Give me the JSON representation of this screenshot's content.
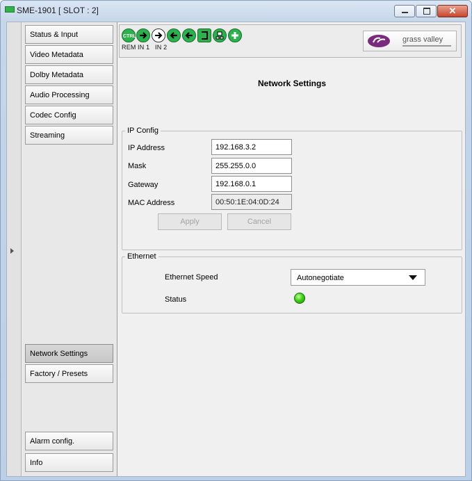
{
  "window": {
    "title": "SME-1901 [ SLOT : 2]",
    "minimize_glyph": "",
    "maximize_glyph": "",
    "close_glyph": "✕"
  },
  "sidebar": {
    "top_items": [
      {
        "label": "Status & Input"
      },
      {
        "label": "Video Metadata"
      },
      {
        "label": "Dolby Metadata"
      },
      {
        "label": "Audio Processing"
      },
      {
        "label": "Codec Config"
      },
      {
        "label": "Streaming"
      }
    ],
    "bottom_items": [
      {
        "label": "Network Settings",
        "active": true
      },
      {
        "label": "Factory / Presets"
      },
      {
        "label": "Alarm config."
      },
      {
        "label": "Info"
      }
    ]
  },
  "toolbar": {
    "ctrl_badge": "CTRL",
    "labels": [
      "REM",
      "IN 1",
      "IN 2"
    ],
    "logo_text": "grass valley",
    "status_color": "#2bb24c"
  },
  "page": {
    "title": "Network Settings"
  },
  "ip_config": {
    "legend": "IP Config",
    "ip_address_label": "IP Address",
    "ip_address": "192.168.3.2",
    "mask_label": "Mask",
    "mask": "255.255.0.0",
    "gateway_label": "Gateway",
    "gateway": "192.168.0.1",
    "mac_label": "MAC Address",
    "mac": "00:50:1E:04:0D:24",
    "apply_label": "Apply",
    "cancel_label": "Cancel"
  },
  "ethernet": {
    "legend": "Ethernet",
    "speed_label": "Ethernet Speed",
    "speed_value": "Autonegotiate",
    "status_label": "Status",
    "status_color": "#42d01a"
  }
}
